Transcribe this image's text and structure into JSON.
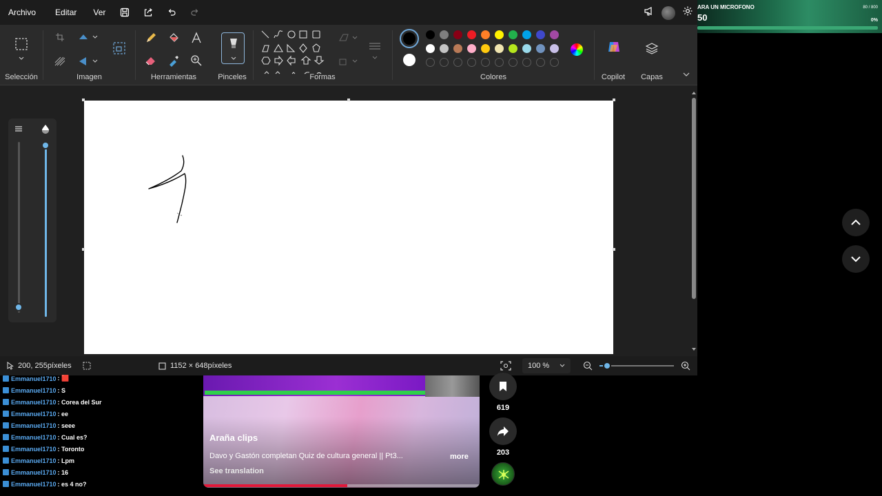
{
  "menu": {
    "archivo": "Archivo",
    "editar": "Editar",
    "ver": "Ver"
  },
  "ribbon": {
    "seleccion": "Selección",
    "imagen": "Imagen",
    "herramientas": "Herramientas",
    "pinceles": "Pinceles",
    "formas": "Formas",
    "colores": "Colores",
    "copilot": "Copilot",
    "capas": "Capas"
  },
  "colors": {
    "primary": "#000000",
    "secondary": "#ffffff",
    "palette_row1": [
      "#000000",
      "#7f7f7f",
      "#880015",
      "#ed1c24",
      "#ff7f27",
      "#fff200",
      "#22b14c",
      "#00a2e8",
      "#3f48cc",
      "#a349a4"
    ],
    "palette_row2": [
      "#ffffff",
      "#c3c3c3",
      "#b97a57",
      "#ffaec9",
      "#ffc90e",
      "#efe4b0",
      "#b5e61d",
      "#99d9ea",
      "#7092be",
      "#c8bfe7"
    ]
  },
  "status": {
    "cursor_pos": "200, 255píxeles",
    "canvas_size": "1152 × 648píxeles",
    "zoom": "100 %",
    "zoom_level": 0.1
  },
  "overlay": {
    "title": "ARA UN MICROFONO",
    "count": "80 / 800",
    "number": "50",
    "percent": "0%"
  },
  "chat": {
    "messages": [
      {
        "user": "Emmanuel1710",
        "text": ": 🟥"
      },
      {
        "user": "Emmanuel1710",
        "text": ": S"
      },
      {
        "user": "Emmanuel1710",
        "text": ": Corea del Sur"
      },
      {
        "user": "Emmanuel1710",
        "text": ": ee"
      },
      {
        "user": "Emmanuel1710",
        "text": ": seee"
      },
      {
        "user": "Emmanuel1710",
        "text": ": Cual es?"
      },
      {
        "user": "Emmanuel1710",
        "text": ": Toronto"
      },
      {
        "user": "Emmanuel1710",
        "text": ": Lpm"
      },
      {
        "user": "Emmanuel1710",
        "text": ": 16"
      },
      {
        "user": "Emmanuel1710",
        "text": ": es 4 no?"
      }
    ]
  },
  "video": {
    "channel": "Araña clips",
    "title": "Davo y Gastón completan Quiz de cultura general || Pt3...",
    "more": "more",
    "translate": "See translation",
    "progress": 0.52
  },
  "actions": {
    "save_count": "619",
    "share_count": "203"
  }
}
